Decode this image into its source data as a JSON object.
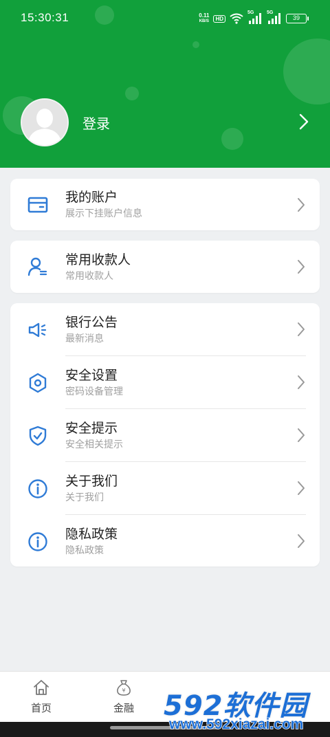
{
  "status_bar": {
    "time": "15:30:31",
    "net_speed": "0.11",
    "net_unit": "KB/S",
    "hd_badge": "HD",
    "signal_label_1": "5G",
    "signal_label_2": "5G",
    "battery": "39"
  },
  "header": {
    "login_label": "登录",
    "brand_color": "#11a03b"
  },
  "account_card": {
    "title": "我的账户",
    "subtitle": "展示下挂账户信息"
  },
  "payee_card": {
    "title": "常用收款人",
    "subtitle": "常用收款人"
  },
  "menu": {
    "items": [
      {
        "title": "银行公告",
        "subtitle": "最新消息",
        "icon": "megaphone-icon"
      },
      {
        "title": "安全设置",
        "subtitle": "密码设备管理",
        "icon": "hexagon-settings-icon"
      },
      {
        "title": "安全提示",
        "subtitle": "安全相关提示",
        "icon": "shield-check-icon"
      },
      {
        "title": "关于我们",
        "subtitle": "关于我们",
        "icon": "info-icon"
      },
      {
        "title": "隐私政策",
        "subtitle": "隐私政策",
        "icon": "info-icon"
      }
    ]
  },
  "bottom_nav": {
    "items": [
      {
        "label": "首页",
        "icon": "home-icon"
      },
      {
        "label": "金融",
        "icon": "money-bag-icon"
      }
    ]
  },
  "watermark": {
    "logo": "592软件园",
    "url": "www.592xiazai.com"
  },
  "colors": {
    "accent_blue": "#2f7bd6",
    "brand_green": "#11a03b"
  }
}
